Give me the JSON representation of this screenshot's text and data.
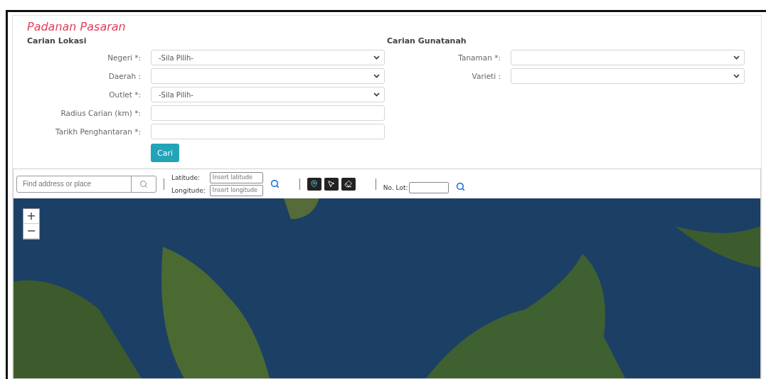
{
  "title": "Padanan Pasaran",
  "location_search": {
    "heading": "Carian Lokasi",
    "fields": [
      {
        "label": "Negeri *:",
        "kind": "select",
        "value": "-Sila Pilih-"
      },
      {
        "label": "Daerah :",
        "kind": "select"
      },
      {
        "label": "Outlet *:",
        "kind": "select",
        "value": "-Sila Pilih-"
      },
      {
        "label": "Radius Carian (km) *:",
        "kind": "text"
      },
      {
        "label": "Tarikh Penghantaran *:",
        "kind": "text"
      }
    ],
    "button": "Cari"
  },
  "landuse_search": {
    "heading": "Carian Gunatanah",
    "fields": [
      {
        "label": "Tanaman *:",
        "kind": "select"
      },
      {
        "label": "Varieti :",
        "kind": "select"
      }
    ]
  },
  "map_toolbar": {
    "search": {
      "placeholder": "Find address or place"
    },
    "latitude": {
      "label": "Latitude:",
      "placeholder": "Insert latitude"
    },
    "longitude": {
      "label": "Longitude:",
      "placeholder": "Insert longitude"
    },
    "lot": {
      "label": "No. Lot:"
    }
  },
  "map": {
    "zoom_in": "+",
    "zoom_out": "−"
  }
}
